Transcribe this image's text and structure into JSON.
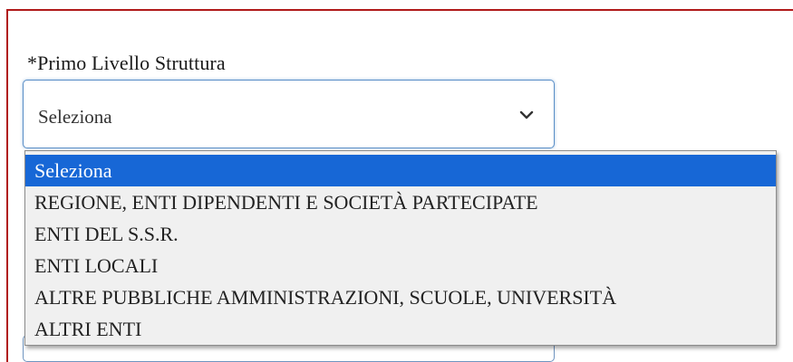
{
  "form": {
    "field_label": "*Primo Livello Struttura",
    "select": {
      "selected_value": "Seleziona",
      "icon": "chevron-down-icon"
    },
    "options": [
      "Seleziona",
      "REGIONE, ENTI DIPENDENTI E SOCIETÀ PARTECIPATE",
      "ENTI DEL S.S.R.",
      "ENTI LOCALI",
      "ALTRE PUBBLICHE AMMINISTRAZIONI, SCUOLE, UNIVERSITÀ",
      "ALTRI ENTI"
    ],
    "highlighted_option_index": 0
  },
  "colors": {
    "frame_border": "#b01a1a",
    "select_border": "#5b8fc7",
    "highlight": "#1767d6",
    "dropdown_bg": "#f0f0f0"
  }
}
